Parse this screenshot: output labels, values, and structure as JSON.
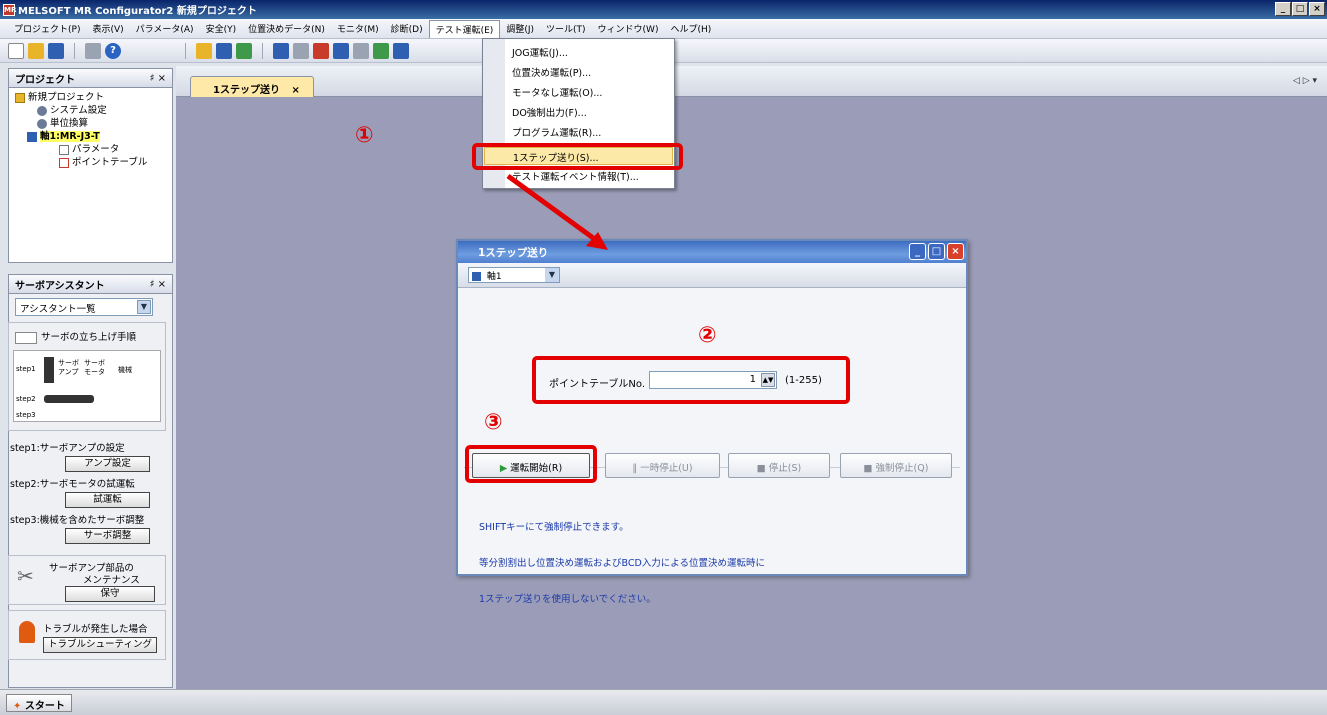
{
  "window": {
    "title": "MELSOFT MR Configurator2 新規プロジェクト",
    "app_icon": "MR",
    "btn_min": "_",
    "btn_max": "□",
    "btn_close": "×"
  },
  "menu": [
    "プロジェクト(P)",
    "表示(V)",
    "パラメータ(A)",
    "安全(Y)",
    "位置決めデータ(N)",
    "モニタ(M)",
    "診断(D)",
    "テスト運転(E)",
    "調整(J)",
    "ツール(T)",
    "ウィンドウ(W)",
    "ヘルプ(H)"
  ],
  "project_panel": {
    "title": "プロジェクト",
    "pin": "♯ ×",
    "tree": [
      "新規プロジェクト",
      "システム設定",
      "単位換算",
      "軸1:MR-J3-T",
      "パラメータ",
      "ポイントテーブル"
    ]
  },
  "assistant_panel": {
    "title": "サーボアシスタント",
    "pin": "♯ ×",
    "dropdown": "アシスタント一覧",
    "startup_title": "サーボの立ち上げ手順",
    "diagram_labels": [
      "step1",
      "サーボ アンプ",
      "サーボ モータ",
      "機械",
      "step2",
      "step3"
    ],
    "step1": "step1:サーボアンプの設定",
    "step1_btn": "アンプ設定",
    "step2": "step2:サーボモータの試運転",
    "step2_btn": "試運転",
    "step3": "step3:機械を含めたサーボ調整",
    "step3_btn": "サーボ調整",
    "maint_title": "サーボアンプ部品の",
    "maint_title2": "メンテナンス",
    "maint_btn": "保守",
    "trouble_title": "トラブルが発生した場合",
    "trouble_btn": "トラブルシューティング"
  },
  "tab": {
    "label": "1ステップ送り",
    "close": "×",
    "nav": "◁ ▷ ▾"
  },
  "test_menu": {
    "items": [
      "JOG運転(J)...",
      "位置決め運転(P)...",
      "モータなし運転(O)...",
      "DO強制出力(F)...",
      "プログラム運転(R)...",
      "1ステップ送り(S)...",
      "テスト運転イベント情報(T)..."
    ],
    "selected_index": 5
  },
  "markers": {
    "m1": "①",
    "m2": "②",
    "m3": "③"
  },
  "dialog": {
    "title": "1ステップ送り",
    "axis": "軸1",
    "point_table_label": "ポイントテーブルNo.",
    "point_table_value": "1",
    "range": "(1-255)",
    "btn_start": "運転開始(R)",
    "btn_pause": "一時停止(U)",
    "btn_stop": "停止(S)",
    "btn_force_stop": "強制停止(Q)",
    "note_line1": "SHIFTキーにて強制停止できます。",
    "note_line2": "等分割割出し位置決め運転およびBCD入力による位置決め運転時に",
    "note_line3": "1ステップ送りを使用しないでください。"
  },
  "taskbar": {
    "start": "スタート"
  },
  "colors": {
    "accent_red": "#e30000",
    "highlight": "#fde9a7",
    "workspace": "#9b9db8"
  }
}
